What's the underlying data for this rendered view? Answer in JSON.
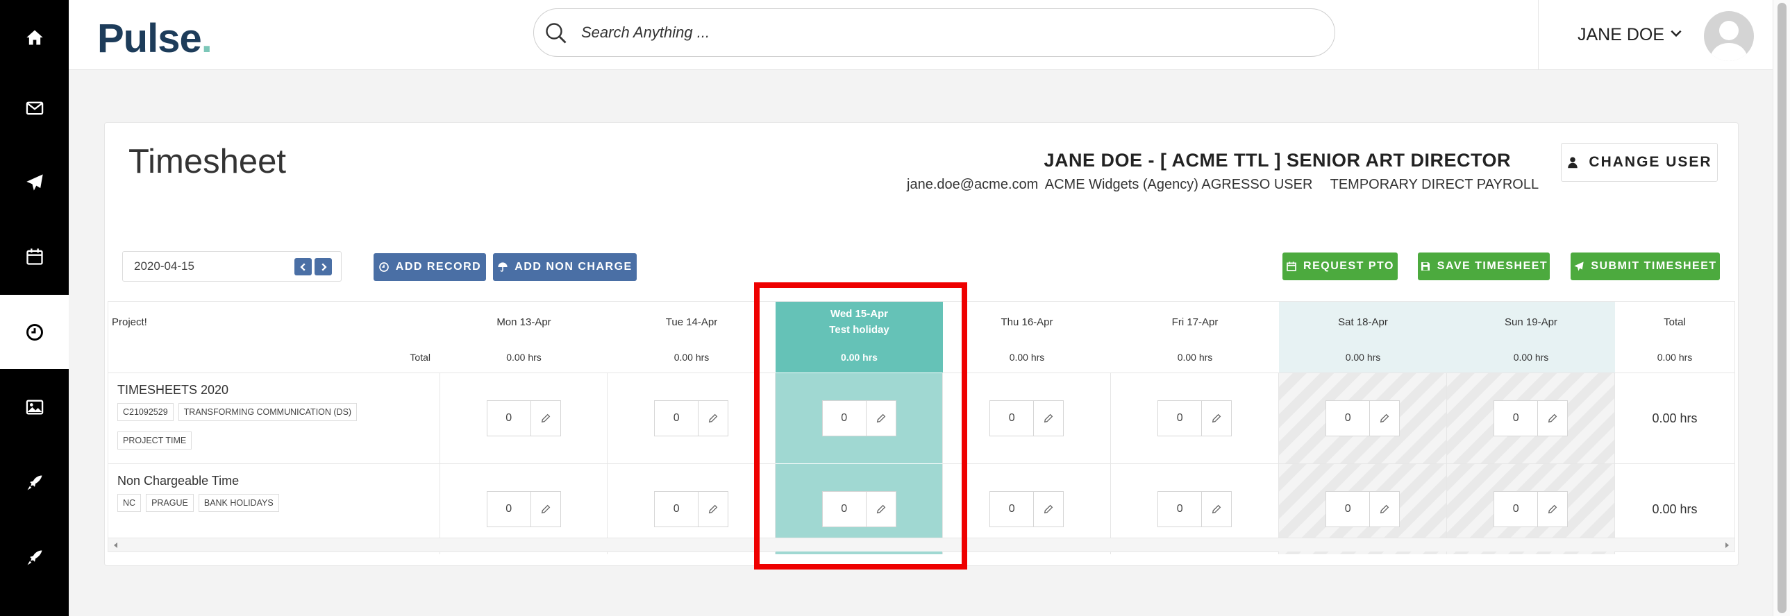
{
  "app": {
    "logo_text": "Pulse",
    "logo_dot": "."
  },
  "search": {
    "placeholder": "Search Anything ..."
  },
  "user": {
    "name": "JANE DOE"
  },
  "sidebar": {
    "items": [
      {
        "icon": "home-icon"
      },
      {
        "icon": "mail-icon"
      },
      {
        "icon": "send-icon"
      },
      {
        "icon": "calendar-icon"
      },
      {
        "icon": "clock-icon",
        "active": true
      },
      {
        "icon": "image-icon"
      },
      {
        "icon": "rocket-icon"
      },
      {
        "icon": "rocket-icon"
      }
    ]
  },
  "page": {
    "title": "Timesheet",
    "employee_title": "JANE DOE - [ ACME TTL ] SENIOR ART DIRECTOR",
    "email": "jane.doe@acme.com",
    "company": "ACME Widgets (Agency) AGRESSO USER",
    "payroll": "TEMPORARY DIRECT PAYROLL",
    "change_user_label": "CHANGE USER"
  },
  "toolbar": {
    "date": "2020-04-15",
    "add_record": "ADD RECORD",
    "add_non_charge": "ADD NON CHARGE",
    "request_pto": "REQUEST PTO",
    "save_timesheet": "SAVE TIMESHEET",
    "submit_timesheet": "SUBMIT TIMESHEET"
  },
  "table": {
    "project_header": "Project!",
    "total_label": "Total",
    "total_col_header": "Total",
    "total_col_value": "0.00 hrs",
    "days": [
      {
        "label": "Mon 13-Apr",
        "total": "0.00 hrs",
        "type": "normal"
      },
      {
        "label": "Tue 14-Apr",
        "total": "0.00 hrs",
        "type": "normal"
      },
      {
        "label": "Wed 15-Apr",
        "sub": "Test holiday",
        "total": "0.00 hrs",
        "type": "holiday"
      },
      {
        "label": "Thu 16-Apr",
        "total": "0.00 hrs",
        "type": "normal"
      },
      {
        "label": "Fri 17-Apr",
        "total": "0.00 hrs",
        "type": "normal"
      },
      {
        "label": "Sat 18-Apr",
        "total": "0.00 hrs",
        "type": "weekend"
      },
      {
        "label": "Sun 19-Apr",
        "total": "0.00 hrs",
        "type": "weekend"
      }
    ],
    "rows": [
      {
        "name": "TIMESHEETS 2020",
        "tags": [
          "C21092529",
          "TRANSFORMING COMMUNICATION (DS)",
          "PROJECT TIME"
        ],
        "values": [
          "0",
          "0",
          "0",
          "0",
          "0",
          "0",
          "0"
        ],
        "total": "0.00 hrs"
      },
      {
        "name": "Non Chargeable Time",
        "tags": [
          "NC",
          "PRAGUE",
          "BANK HOLIDAYS"
        ],
        "values": [
          "0",
          "0",
          "0",
          "0",
          "0",
          "0",
          "0"
        ],
        "total": "0.00 hrs"
      }
    ]
  },
  "colors": {
    "accent_blue": "#4a6fa5",
    "accent_green": "#4caa3e",
    "holiday": "#65c2b7",
    "highlight": "#ee0000"
  }
}
